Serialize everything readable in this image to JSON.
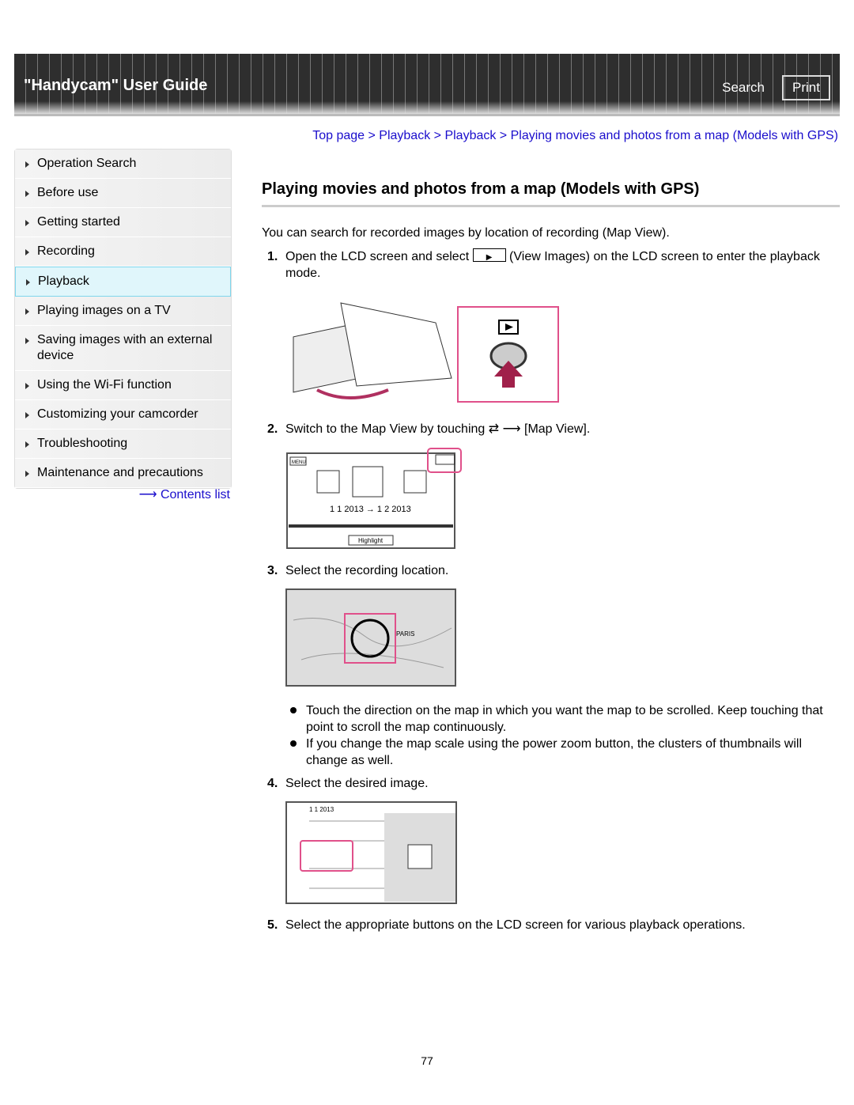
{
  "header": {
    "title": "\"Handycam\" User Guide",
    "search": "Search",
    "print": "Print"
  },
  "breadcrumb": [
    "Top page",
    "Playback",
    "Playback",
    "Playing movies and photos from a map (Models with GPS)"
  ],
  "sidebar": {
    "items": [
      "Operation Search",
      "Before use",
      "Getting started",
      "Recording",
      "Playback",
      "Playing images on a TV",
      "Saving images with an external device",
      "Using the Wi-Fi function",
      "Customizing your camcorder",
      "Troubleshooting",
      "Maintenance and precautions"
    ],
    "active": "Playback",
    "contents_link": "Contents list"
  },
  "main": {
    "title": "Playing movies and photos from a map (Models with GPS)",
    "intro": "You can search for recorded images by location of recording (Map View).",
    "steps": [
      {
        "num": "1.",
        "pre": "Open the LCD screen and select",
        "post": "(View Images) on the LCD screen to enter the playback mode."
      },
      {
        "num": "2.",
        "pre": "Switch to the Map View by touching",
        "post": "[Map View]."
      },
      {
        "num": "3.",
        "text": "Select the recording location."
      },
      {
        "num": "4.",
        "text": "Select the desired image."
      },
      {
        "num": "5.",
        "text": "Select the appropriate buttons on the LCD screen for various playback operations."
      }
    ],
    "bullets": [
      "Touch the direction on the map in which you want the map to be scrolled. Keep touching that point to scroll the map continuously.",
      "If you change the map scale using the power zoom button, the clusters of thumbnails will change as well."
    ],
    "figure_text": {
      "menu": "MENU",
      "dates": "1 1 2013 → 1 2 2013",
      "highlight": "Highlight",
      "date4": "1 1 2013",
      "paris": "PARIS"
    }
  },
  "page_number": "77",
  "colors": {
    "link": "#1a0dcc",
    "highlight": "#e0508a"
  }
}
